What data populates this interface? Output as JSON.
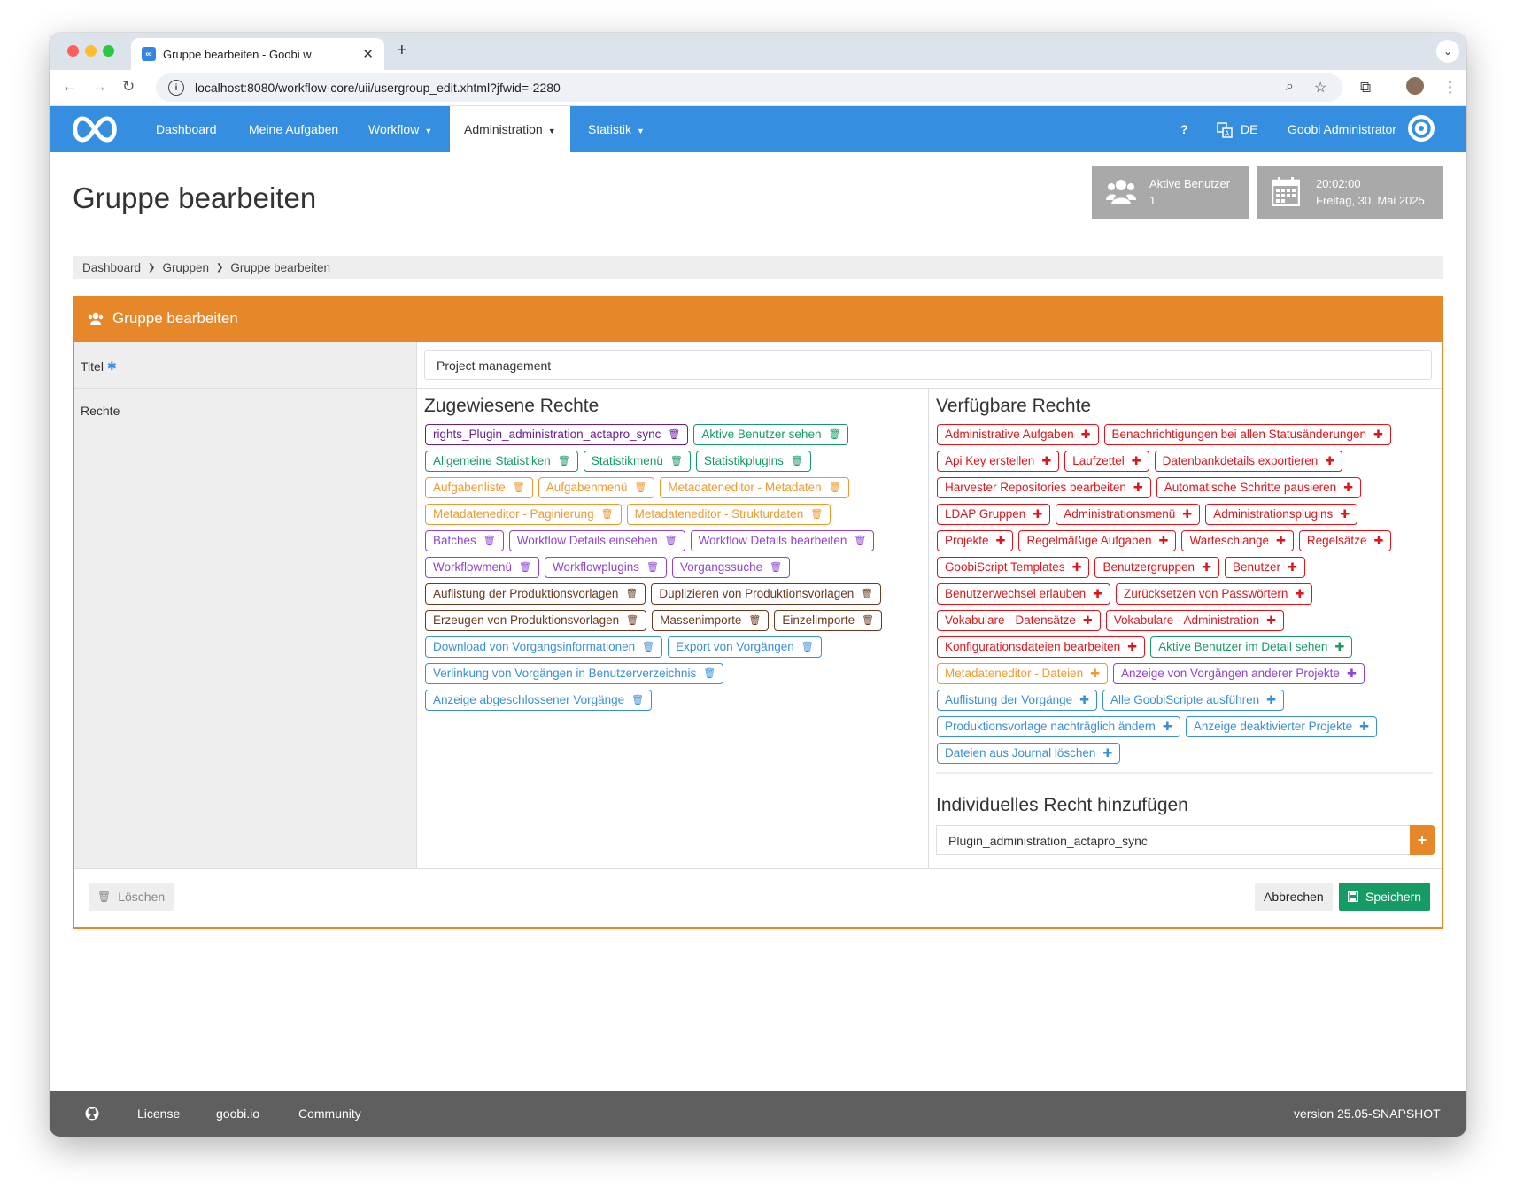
{
  "browser": {
    "tab_title": "Gruppe bearbeiten - Goobi w",
    "url": "localhost:8080/workflow-core/uii/usergroup_edit.xhtml?jfwid=-2280"
  },
  "nav": {
    "items": [
      "Dashboard",
      "Meine Aufgaben",
      "Workflow",
      "Administration",
      "Statistik"
    ],
    "help": "?",
    "lang": "DE",
    "user": "Goobi Administrator"
  },
  "header": {
    "title": "Gruppe bearbeiten",
    "active_users_label": "Aktive Benutzer",
    "active_users_count": "1",
    "time": "20:02:00",
    "date": "Freitag, 30. Mai 2025"
  },
  "breadcrumb": [
    "Dashboard",
    "Gruppen",
    "Gruppe bearbeiten"
  ],
  "form": {
    "box_title": "Gruppe bearbeiten",
    "title_label": "Titel",
    "required_mark": "✱",
    "title_value": "Project management",
    "rights_label": "Rechte",
    "assigned_heading": "Zugewiesene Rechte",
    "available_heading": "Verfügbare Rechte",
    "individual_heading": "Individuelles Recht hinzufügen",
    "individual_value": "Plugin_administration_actapro_sync",
    "add_symbol": "+",
    "delete_label": "Löschen",
    "cancel_label": "Abbrechen",
    "save_label": "Speichern"
  },
  "colors": {
    "purple": "#6a1b9a",
    "green": "#159b63",
    "orange": "#ef9a2e",
    "violet": "#8e44d6",
    "brown": "#6b3a1f",
    "blue": "#3a8fd8",
    "red": "#e0151c",
    "nav_blue": "#368ee0",
    "box_orange": "#e6882a",
    "save_green": "#159b63"
  },
  "assigned_rights": [
    {
      "label": "rights_Plugin_administration_actapro_sync",
      "color": "purple"
    },
    {
      "label": "Aktive Benutzer sehen",
      "color": "green"
    },
    {
      "label": "Allgemeine Statistiken",
      "color": "green"
    },
    {
      "label": "Statistikmenü",
      "color": "green"
    },
    {
      "label": "Statistikplugins",
      "color": "green"
    },
    {
      "label": "Aufgabenliste",
      "color": "orange"
    },
    {
      "label": "Aufgabenmenü",
      "color": "orange"
    },
    {
      "label": "Metadateneditor - Metadaten",
      "color": "orange"
    },
    {
      "label": "Metadateneditor - Paginierung",
      "color": "orange"
    },
    {
      "label": "Metadateneditor - Strukturdaten",
      "color": "orange"
    },
    {
      "label": "Batches",
      "color": "violet"
    },
    {
      "label": "Workflow Details einsehen",
      "color": "violet"
    },
    {
      "label": "Workflow Details bearbeiten",
      "color": "violet"
    },
    {
      "label": "Workflowmenü",
      "color": "violet"
    },
    {
      "label": "Workflowplugins",
      "color": "violet"
    },
    {
      "label": "Vorgangssuche",
      "color": "violet"
    },
    {
      "label": "Auflistung der Produktionsvorlagen",
      "color": "brown"
    },
    {
      "label": "Duplizieren von Produktionsvorlagen",
      "color": "brown"
    },
    {
      "label": "Erzeugen von Produktionsvorlagen",
      "color": "brown"
    },
    {
      "label": "Massenimporte",
      "color": "brown"
    },
    {
      "label": "Einzelimporte",
      "color": "brown"
    },
    {
      "label": "Download von Vorgangsinformationen",
      "color": "blue"
    },
    {
      "label": "Export von Vorgängen",
      "color": "blue"
    },
    {
      "label": "Verlinkung von Vorgängen in Benutzerverzeichnis",
      "color": "blue"
    },
    {
      "label": "Anzeige abgeschlossener Vorgänge",
      "color": "blue"
    }
  ],
  "available_rights": [
    {
      "label": "Administrative Aufgaben",
      "color": "red"
    },
    {
      "label": "Benachrichtigungen bei allen Statusänderungen",
      "color": "red"
    },
    {
      "label": "Api Key erstellen",
      "color": "red"
    },
    {
      "label": "Laufzettel",
      "color": "red"
    },
    {
      "label": "Datenbankdetails exportieren",
      "color": "red"
    },
    {
      "label": "Harvester Repositories bearbeiten",
      "color": "red"
    },
    {
      "label": "Automatische Schritte pausieren",
      "color": "red"
    },
    {
      "label": "LDAP Gruppen",
      "color": "red"
    },
    {
      "label": "Administrationsmenü",
      "color": "red"
    },
    {
      "label": "Administrationsplugins",
      "color": "red"
    },
    {
      "label": "Projekte",
      "color": "red"
    },
    {
      "label": "Regelmäßige Aufgaben",
      "color": "red"
    },
    {
      "label": "Warteschlange",
      "color": "red"
    },
    {
      "label": "Regelsätze",
      "color": "red"
    },
    {
      "label": "GoobiScript Templates",
      "color": "red"
    },
    {
      "label": "Benutzergruppen",
      "color": "red"
    },
    {
      "label": "Benutzer",
      "color": "red"
    },
    {
      "label": "Benutzerwechsel erlauben",
      "color": "red"
    },
    {
      "label": "Zurücksetzen von Passwörtern",
      "color": "red"
    },
    {
      "label": "Vokabulare - Datensätze",
      "color": "red"
    },
    {
      "label": "Vokabulare - Administration",
      "color": "red"
    },
    {
      "label": "Konfigurationsdateien bearbeiten",
      "color": "red"
    },
    {
      "label": "Aktive Benutzer im Detail sehen",
      "color": "green"
    },
    {
      "label": "Metadateneditor - Dateien",
      "color": "orange"
    },
    {
      "label": "Anzeige von Vorgängen anderer Projekte",
      "color": "violet"
    },
    {
      "label": "Auflistung der Vorgänge",
      "color": "blue"
    },
    {
      "label": "Alle GoobiScripte ausführen",
      "color": "blue"
    },
    {
      "label": "Produktionsvorlage nachträglich ändern",
      "color": "blue"
    },
    {
      "label": "Anzeige deaktivierter Projekte",
      "color": "blue"
    },
    {
      "label": "Dateien aus Journal löschen",
      "color": "blue"
    }
  ],
  "footer": {
    "license": "License",
    "site": "goobi.io",
    "community": "Community",
    "version": "version 25.05-SNAPSHOT"
  }
}
